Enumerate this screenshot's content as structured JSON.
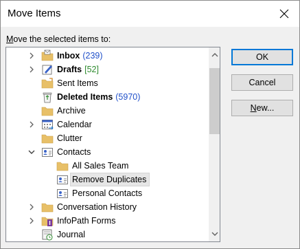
{
  "window": {
    "title": "Move Items"
  },
  "prompt": {
    "prefix": "M",
    "rest": "ove the selected items to:"
  },
  "tree": [
    {
      "name": "Inbox",
      "count": "(239)",
      "bold": true,
      "count_color": "blue",
      "icon": "inbox-icon",
      "chevron": "right"
    },
    {
      "name": "Drafts",
      "count": "[52]",
      "bold": true,
      "count_color": "green",
      "icon": "drafts-icon",
      "chevron": "right"
    },
    {
      "name": "Sent Items",
      "count": "",
      "bold": false,
      "icon": "sent-items-icon",
      "chevron": ""
    },
    {
      "name": "Deleted Items",
      "count": "(5970)",
      "bold": true,
      "count_color": "blue",
      "icon": "recycle-bin-icon",
      "chevron": ""
    },
    {
      "name": "Archive",
      "count": "",
      "bold": false,
      "icon": "folder-icon",
      "chevron": ""
    },
    {
      "name": "Calendar",
      "count": "",
      "bold": false,
      "icon": "calendar-icon",
      "chevron": "right"
    },
    {
      "name": "Clutter",
      "count": "",
      "bold": false,
      "icon": "folder-icon",
      "chevron": ""
    },
    {
      "name": "Contacts",
      "count": "",
      "bold": false,
      "icon": "contacts-icon",
      "chevron": "down"
    },
    {
      "name": "All Sales Team",
      "count": "",
      "bold": false,
      "icon": "folder-icon",
      "chevron": ""
    },
    {
      "name": "Remove Duplicates",
      "count": "",
      "bold": false,
      "icon": "contacts-icon",
      "chevron": "",
      "selected": true
    },
    {
      "name": "Personal Contacts",
      "count": "",
      "bold": false,
      "icon": "contacts-icon",
      "chevron": ""
    },
    {
      "name": "Conversation History",
      "count": "",
      "bold": false,
      "icon": "folder-icon",
      "chevron": "right"
    },
    {
      "name": "InfoPath Forms",
      "count": "",
      "bold": false,
      "icon": "infopath-icon",
      "chevron": "right"
    },
    {
      "name": "Journal",
      "count": "",
      "bold": false,
      "icon": "journal-icon",
      "chevron": ""
    }
  ],
  "buttons": {
    "ok": "OK",
    "cancel": "Cancel",
    "new_prefix": "N",
    "new_rest": "ew..."
  }
}
